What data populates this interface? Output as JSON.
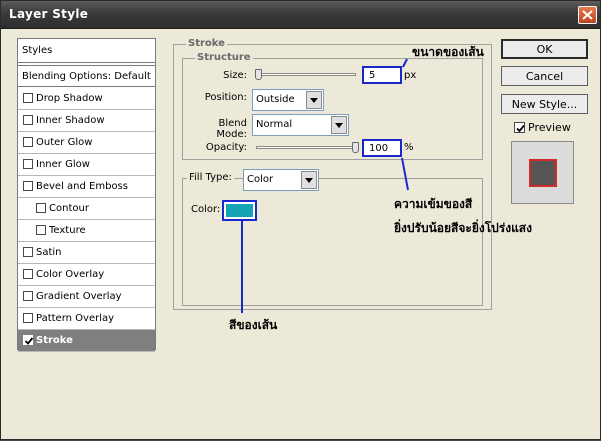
{
  "window": {
    "title": "Layer Style"
  },
  "styles_panel": {
    "header": "Styles",
    "blending_options": "Blending Options: Default",
    "items": [
      {
        "label": "Drop Shadow",
        "checked": false,
        "sub": false
      },
      {
        "label": "Inner Shadow",
        "checked": false,
        "sub": false
      },
      {
        "label": "Outer Glow",
        "checked": false,
        "sub": false
      },
      {
        "label": "Inner Glow",
        "checked": false,
        "sub": false
      },
      {
        "label": "Bevel and Emboss",
        "checked": false,
        "sub": false
      },
      {
        "label": "Contour",
        "checked": false,
        "sub": true
      },
      {
        "label": "Texture",
        "checked": false,
        "sub": true
      },
      {
        "label": "Satin",
        "checked": false,
        "sub": false
      },
      {
        "label": "Color Overlay",
        "checked": false,
        "sub": false
      },
      {
        "label": "Gradient Overlay",
        "checked": false,
        "sub": false
      },
      {
        "label": "Pattern Overlay",
        "checked": false,
        "sub": false
      },
      {
        "label": "Stroke",
        "checked": true,
        "sub": false,
        "active": true
      }
    ]
  },
  "stroke": {
    "group_label": "Stroke",
    "structure_label": "Structure",
    "size_label": "Size:",
    "size_value": "5",
    "size_unit": "px",
    "position_label": "Position:",
    "position_value": "Outside",
    "blend_mode_label": "Blend Mode:",
    "blend_mode_value": "Normal",
    "opacity_label": "Opacity:",
    "opacity_value": "100",
    "opacity_unit": "%",
    "fill_type_label": "Fill Type:",
    "fill_type_value": "Color",
    "color_label": "Color:",
    "color_hex": "#14a3b5",
    "size_slider_fraction": 0.02,
    "opacity_slider_fraction": 1.0
  },
  "buttons": {
    "ok": "OK",
    "cancel": "Cancel",
    "new_style": "New Style...",
    "preview_label": "Preview",
    "preview_checked": true
  },
  "annotations": {
    "size_note": "ขนาดของเส้น",
    "opacity_note_1": "ความเข้มของสี",
    "opacity_note_2": "ยิ่งปรับน้อยสีจะยิ่งโปร่งแสง",
    "color_note": "สีของเส้น"
  },
  "colors": {
    "annotation_line": "#1a28c8",
    "stroke_preview": "#d42a2a"
  }
}
